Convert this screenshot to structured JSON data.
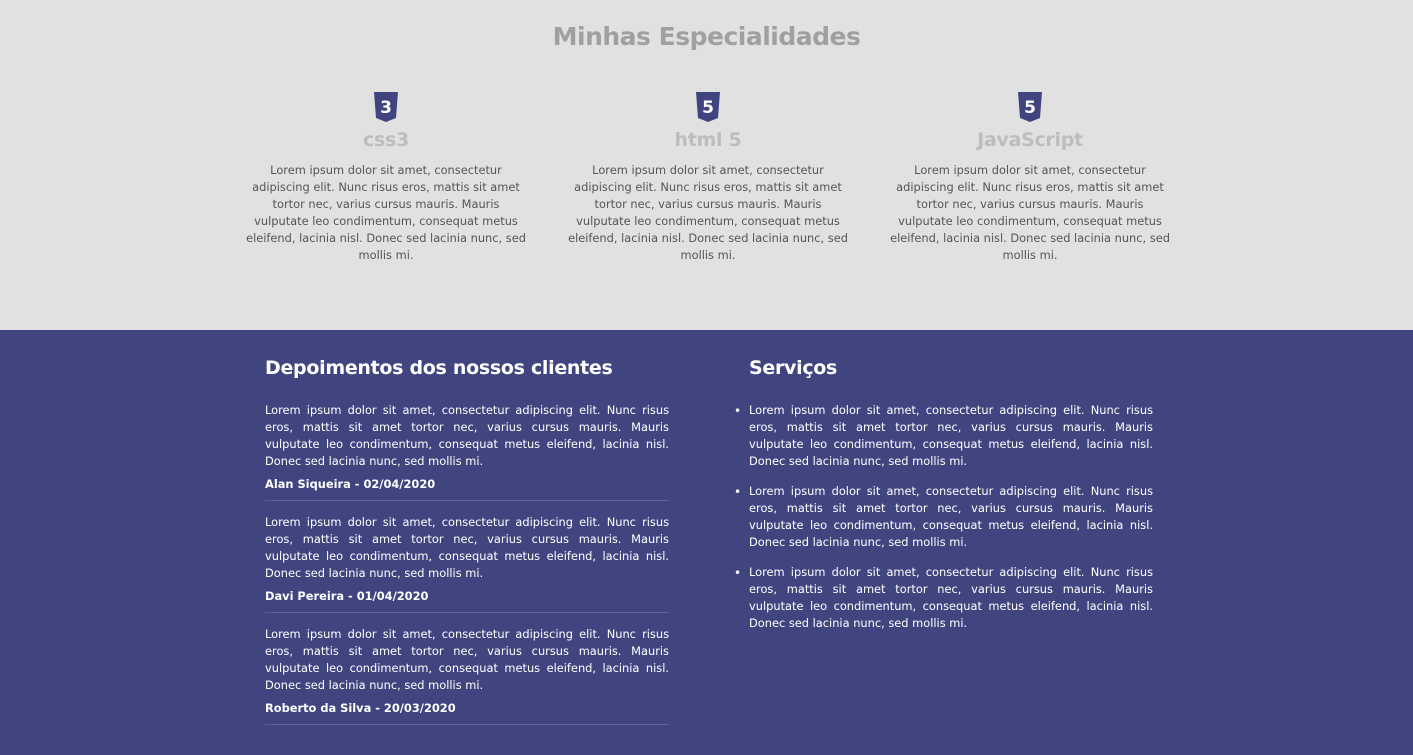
{
  "colors": {
    "page_background": "#e1e1e1",
    "section_background": "#404580",
    "icon_color": "#404580"
  },
  "specialties": {
    "title": "Minhas Especialidades",
    "items": [
      {
        "icon": "css3-icon",
        "icon_glyph": "3",
        "name": "css3",
        "text": "Lorem ipsum dolor sit amet, consectetur adipiscing elit. Nunc risus eros, mattis sit amet tortor nec, varius cursus mauris. Mauris vulputate leo condimentum, consequat metus eleifend, lacinia nisl. Donec sed lacinia nunc, sed mollis mi."
      },
      {
        "icon": "html5-icon",
        "icon_glyph": "5",
        "name": "html 5",
        "text": "Lorem ipsum dolor sit amet, consectetur adipiscing elit. Nunc risus eros, mattis sit amet tortor nec, varius cursus mauris. Mauris vulputate leo condimentum, consequat metus eleifend, lacinia nisl. Donec sed lacinia nunc, sed mollis mi."
      },
      {
        "icon": "html5-icon",
        "icon_glyph": "5",
        "name": "JavaScript",
        "text": "Lorem ipsum dolor sit amet, consectetur adipiscing elit. Nunc risus eros, mattis sit amet tortor nec, varius cursus mauris. Mauris vulputate leo condimentum, consequat metus eleifend, lacinia nisl. Donec sed lacinia nunc, sed mollis mi."
      }
    ]
  },
  "testimonials": {
    "title": "Depoimentos dos nossos clientes",
    "items": [
      {
        "text": "Lorem ipsum dolor sit amet, consectetur adipiscing elit. Nunc risus eros, mattis sit amet tortor nec, varius cursus mauris. Mauris vulputate leo condimentum, consequat metus eleifend, lacinia nisl. Donec sed lacinia nunc, sed mollis mi.",
        "author": "Alan Siqueira - 02/04/2020"
      },
      {
        "text": "Lorem ipsum dolor sit amet, consectetur adipiscing elit. Nunc risus eros, mattis sit amet tortor nec, varius cursus mauris. Mauris vulputate leo condimentum, consequat metus eleifend, lacinia nisl. Donec sed lacinia nunc, sed mollis mi.",
        "author": "Davi Pereira - 01/04/2020"
      },
      {
        "text": "Lorem ipsum dolor sit amet, consectetur adipiscing elit. Nunc risus eros, mattis sit amet tortor nec, varius cursus mauris. Mauris vulputate leo condimentum, consequat metus eleifend, lacinia nisl. Donec sed lacinia nunc, sed mollis mi.",
        "author": "Roberto da Silva - 20/03/2020"
      }
    ]
  },
  "services": {
    "title": "Serviços",
    "items": [
      "Lorem ipsum dolor sit amet, consectetur adipiscing elit. Nunc risus eros, mattis sit amet tortor nec, varius cursus mauris. Mauris vulputate leo condimentum, consequat metus eleifend, lacinia nisl. Donec sed lacinia nunc, sed mollis mi.",
      "Lorem ipsum dolor sit amet, consectetur adipiscing elit. Nunc risus eros, mattis sit amet tortor nec, varius cursus mauris. Mauris vulputate leo condimentum, consequat metus eleifend, lacinia nisl. Donec sed lacinia nunc, sed mollis mi.",
      "Lorem ipsum dolor sit amet, consectetur adipiscing elit. Nunc risus eros, mattis sit amet tortor nec, varius cursus mauris. Mauris vulputate leo condimentum, consequat metus eleifend, lacinia nisl. Donec sed lacinia nunc, sed mollis mi."
    ]
  }
}
